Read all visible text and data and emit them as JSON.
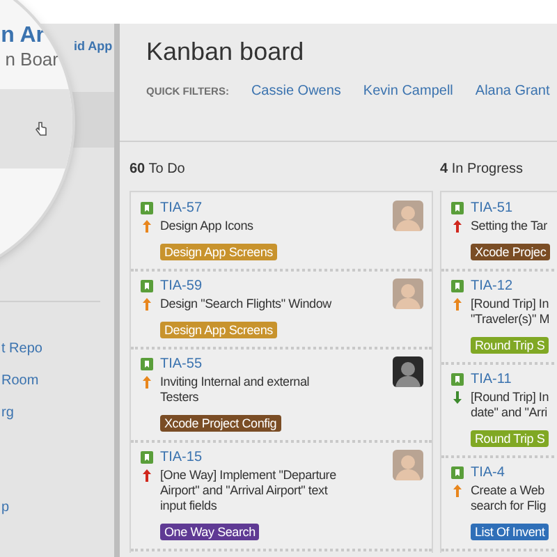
{
  "sidebar": {
    "magnifier": {
      "title": "n Ar",
      "subtitle": "n Boar"
    },
    "project_title": "id App",
    "links": [
      "t Repo",
      "Room",
      "rg",
      "p"
    ]
  },
  "board": {
    "title": "Kanban board",
    "quick_filters": {
      "label": "QUICK FILTERS:",
      "items": [
        "Cassie Owens",
        "Kevin Campell",
        "Alana Grant"
      ]
    },
    "columns": [
      {
        "count": "60",
        "name": "To Do",
        "cards": [
          {
            "key": "TIA-57",
            "kind": "major",
            "summary": "Design App Icons",
            "label": "Design App Screens",
            "color": "#c8932d",
            "avatar": true
          },
          {
            "key": "TIA-59",
            "kind": "major",
            "summary": "Design \"Search Flights\" Window",
            "label": "Design App Screens",
            "color": "#c8932d",
            "avatar": true
          },
          {
            "key": "TIA-55",
            "kind": "major",
            "summary": "Inviting Internal and external\nTesters",
            "label": "Xcode Project Config",
            "color": "#7a4d25",
            "avatar": true
          },
          {
            "key": "TIA-15",
            "kind": "critical",
            "summary": "[One Way] Implement \"Departure\nAirport\" and \"Arrival Airport\" text\ninput fields",
            "label": "One Way Search",
            "color": "#5f3a94",
            "avatar": true
          }
        ]
      },
      {
        "count": "4",
        "name": "In Progress",
        "cards": [
          {
            "key": "TIA-51",
            "kind": "critical",
            "summary": "Setting the Tar",
            "label": "Xcode Projec",
            "color": "#7a4d25",
            "avatar": false
          },
          {
            "key": "TIA-12",
            "kind": "major",
            "summary": "[Round Trip] In\n\"Traveler(s)\" M",
            "label": "Round Trip S",
            "color": "#80a824",
            "avatar": false
          },
          {
            "key": "TIA-11",
            "kind": "minor",
            "summary": "[Round Trip] In\ndate\" and \"Arri",
            "label": "Round Trip S",
            "color": "#80a824",
            "avatar": false
          },
          {
            "key": "TIA-4",
            "kind": "major",
            "summary": "Create a Web\nsearch for Flig",
            "label": "List Of Invent",
            "color": "#2f6fb8",
            "avatar": false
          }
        ]
      }
    ]
  }
}
